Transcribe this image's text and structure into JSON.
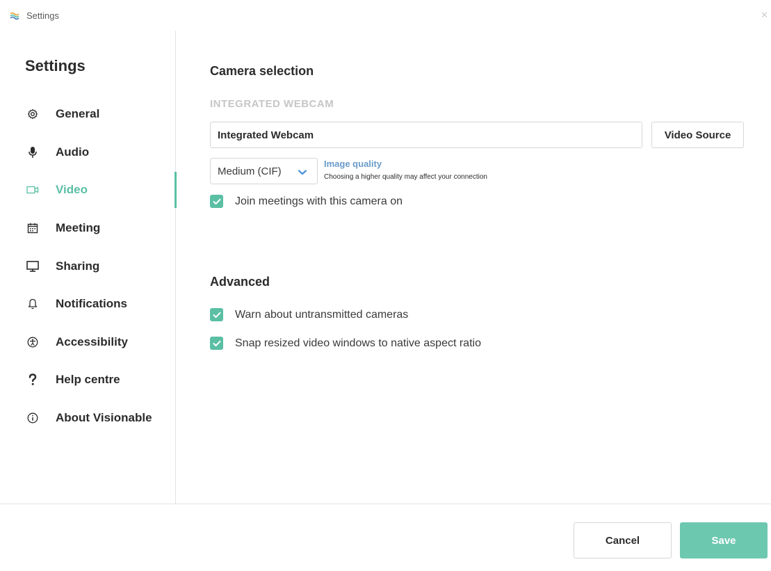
{
  "window": {
    "title": "Settings",
    "logo_icon": "visionable-logo-icon",
    "close_icon": "close-icon"
  },
  "sidebar": {
    "title": "Settings",
    "items": [
      {
        "label": "General",
        "icon": "gear-icon",
        "active": false
      },
      {
        "label": "Audio",
        "icon": "microphone-icon",
        "active": false
      },
      {
        "label": "Video",
        "icon": "video-camera-icon",
        "active": true
      },
      {
        "label": "Meeting",
        "icon": "calendar-icon",
        "active": false
      },
      {
        "label": "Sharing",
        "icon": "monitor-icon",
        "active": false
      },
      {
        "label": "Notifications",
        "icon": "bell-icon",
        "active": false
      },
      {
        "label": "Accessibility",
        "icon": "accessibility-icon",
        "active": false
      },
      {
        "label": "Help centre",
        "icon": "question-icon",
        "active": false
      },
      {
        "label": "About Visionable",
        "icon": "info-icon",
        "active": false
      }
    ]
  },
  "camera": {
    "section_title": "Camera selection",
    "device_label": "INTEGRATED WEBCAM",
    "device_value": "Integrated Webcam",
    "video_source_label": "Video Source",
    "quality_value": "Medium (CIF)",
    "quality_title": "Image quality",
    "quality_hint": "Choosing a higher quality may affect your connection",
    "join_with_camera_label": "Join meetings with this camera on",
    "join_with_camera_checked": true
  },
  "advanced": {
    "section_title": "Advanced",
    "warn_untransmitted_label": "Warn about untransmitted cameras",
    "warn_untransmitted_checked": true,
    "snap_aspect_label": "Snap resized video windows to native aspect ratio",
    "snap_aspect_checked": true
  },
  "footer": {
    "cancel_label": "Cancel",
    "save_label": "Save"
  },
  "colors": {
    "accent": "#5bbfa4",
    "save_button": "#6dc8b0",
    "link": "#6a9cc8",
    "muted_label": "#c6c6c6"
  }
}
